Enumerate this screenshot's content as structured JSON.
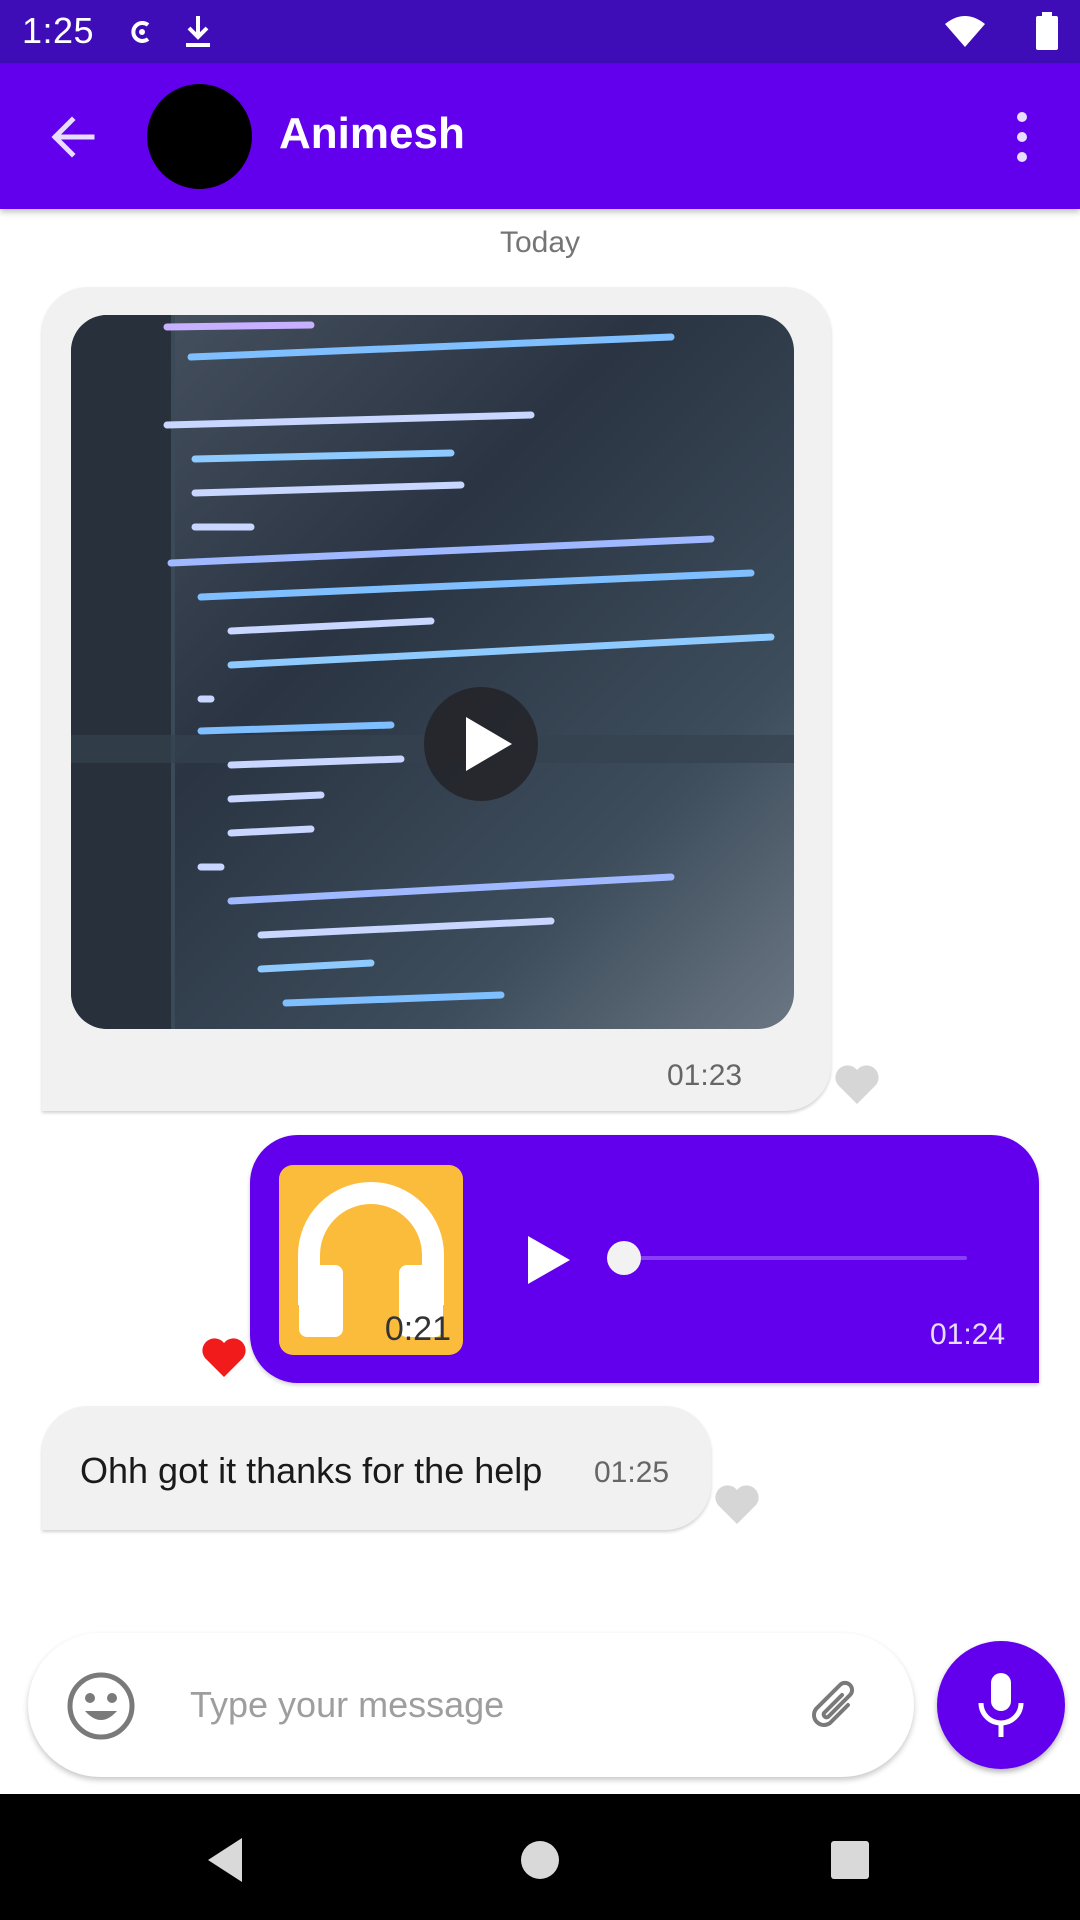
{
  "status_bar": {
    "time": "1:25",
    "icons": [
      "sync-icon",
      "download-icon",
      "wifi-icon",
      "battery-icon"
    ]
  },
  "app_bar": {
    "contact_name": "Animesh",
    "icons": [
      "back-arrow-icon",
      "overflow-menu-icon"
    ]
  },
  "conversation": {
    "date_separator": "Today",
    "messages": [
      {
        "type": "video",
        "direction": "incoming",
        "time": "01:23",
        "liked": false
      },
      {
        "type": "audio",
        "direction": "outgoing",
        "duration": "0:21",
        "time": "01:24",
        "liked": true,
        "progress": 0
      },
      {
        "type": "text",
        "direction": "incoming",
        "text": "Ohh got it thanks for the help",
        "time": "01:25",
        "liked": false
      }
    ]
  },
  "composer": {
    "placeholder": "Type your message",
    "value": "",
    "icons": [
      "emoji-icon",
      "paperclip-icon",
      "microphone-icon"
    ]
  },
  "colors": {
    "primary": "#6200ee",
    "status_bar": "#3f0db8",
    "audio_cover": "#fbbc3c",
    "liked_heart": "#f21b1b",
    "unliked_heart": "#d6d6d6"
  }
}
